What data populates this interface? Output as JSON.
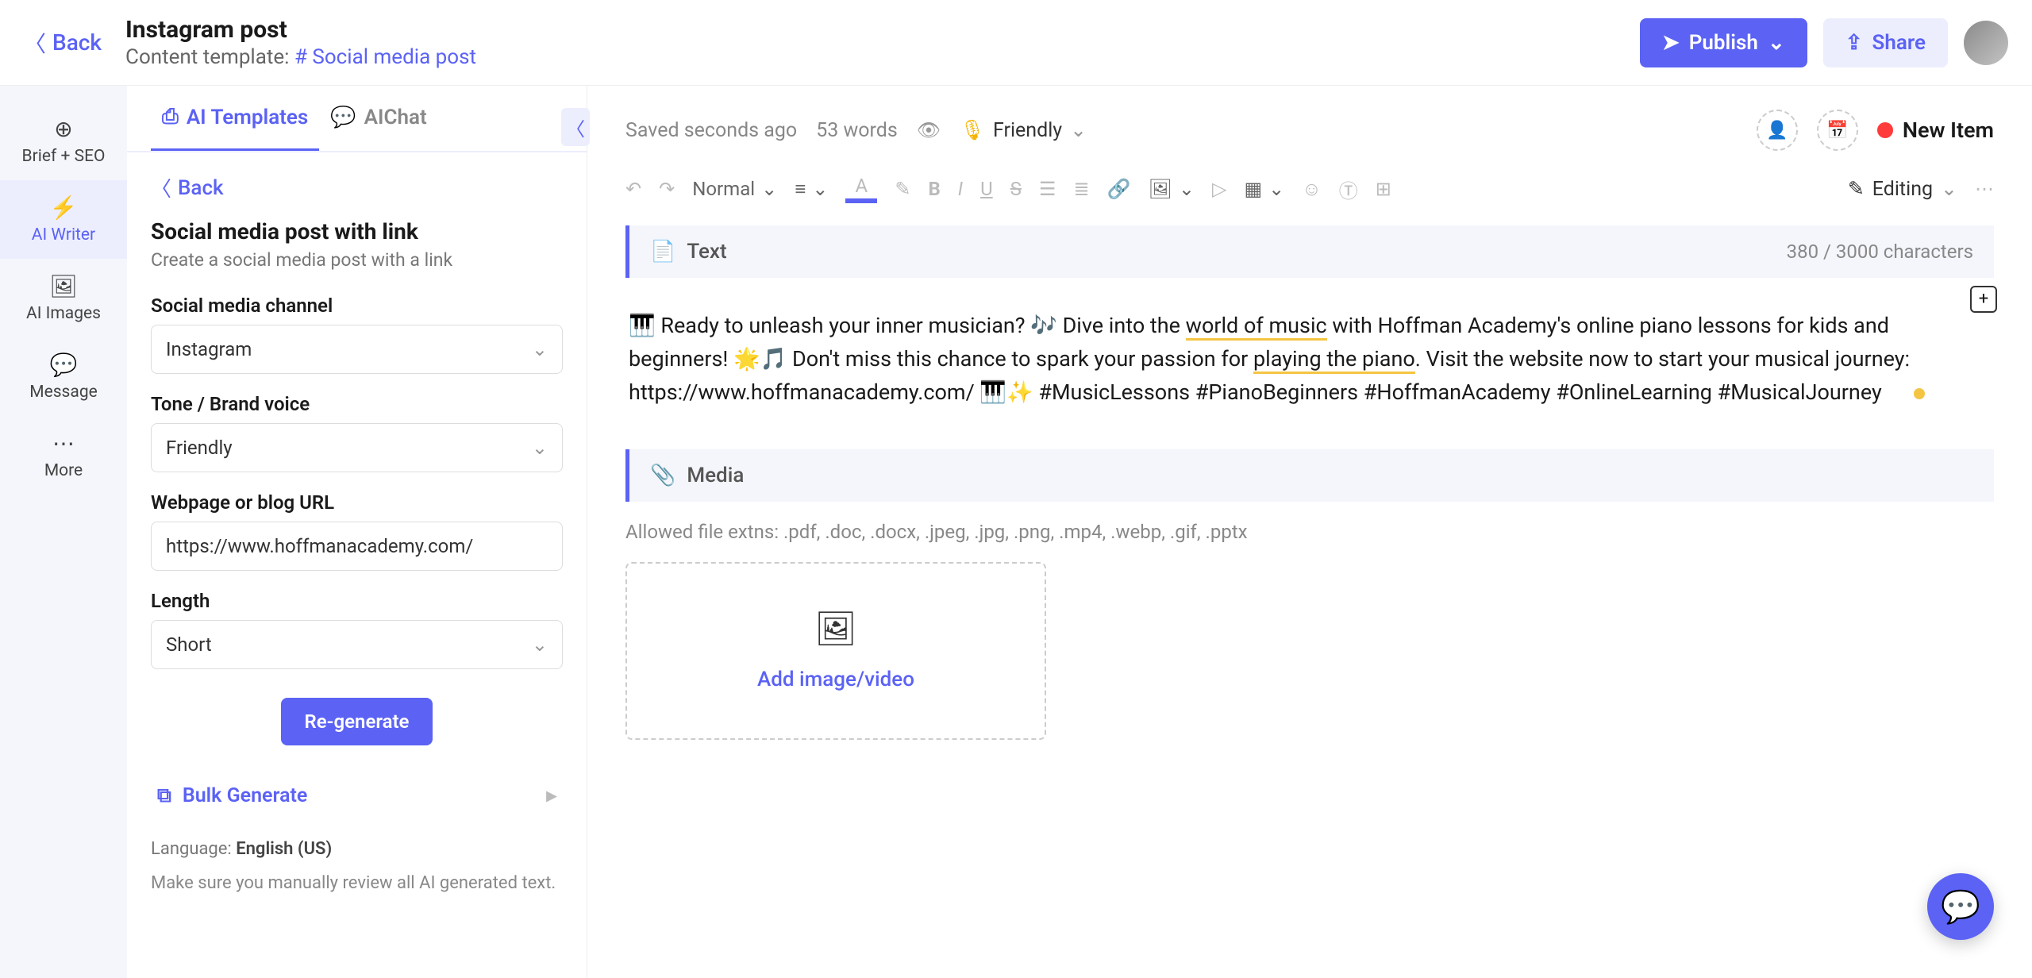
{
  "header": {
    "back": "Back",
    "title": "Instagram post",
    "template_label": "Content template:",
    "template_link": "# Social media post",
    "publish": "Publish",
    "share": "Share"
  },
  "left_nav": [
    {
      "icon": "⊕",
      "label": "Brief + SEO"
    },
    {
      "icon": "⚡",
      "label": "AI Writer"
    },
    {
      "icon": "🖼",
      "label": "AI Images"
    },
    {
      "icon": "💬",
      "label": "Message"
    },
    {
      "icon": "⋯",
      "label": "More"
    }
  ],
  "panel": {
    "tabs": {
      "templates": "AI Templates",
      "chat": "AIChat"
    },
    "back": "Back",
    "title": "Social media post with link",
    "subtitle": "Create a social media post with a link",
    "fields": {
      "channel": {
        "label": "Social media channel",
        "value": "Instagram"
      },
      "tone": {
        "label": "Tone / Brand voice",
        "value": "Friendly"
      },
      "url": {
        "label": "Webpage or blog URL",
        "value": "https://www.hoffmanacademy.com/"
      },
      "length": {
        "label": "Length",
        "value": "Short"
      }
    },
    "regenerate": "Re-generate",
    "bulk": "Bulk Generate",
    "language_label": "Language:",
    "language_value": "English (US)",
    "review_note": "Make sure you manually review all AI generated text."
  },
  "editor": {
    "saved": "Saved seconds ago",
    "words": "53 words",
    "tone": "Friendly",
    "new_item": "New Item",
    "style_select": "Normal",
    "editing_btn": "Editing",
    "text_section": {
      "title": "Text",
      "char_count": "380 / 3000 characters"
    },
    "content": {
      "p1a": "🎹 Ready to unleash your inner musician? 🎶 Dive into the ",
      "p1_u1": "world of music",
      "p1b": " with Hoffman Academy's online piano lessons for kids and beginners! 🌟🎵 Don't miss this chance to spark your passion for ",
      "p1_u2": "playing the piano",
      "p1c": ". Visit the website now to start your musical journey: https://www.hoffmanacademy.com/ 🎹✨ #MusicLessons #PianoBeginners #HoffmanAcademy #OnlineLearning #MusicalJourney"
    },
    "media_section": {
      "title": "Media"
    },
    "allowed_ext": "Allowed file extns: .pdf, .doc, .docx, .jpeg, .jpg, .png, .mp4, .webp, .gif, .pptx",
    "add_media": "Add image/video"
  }
}
